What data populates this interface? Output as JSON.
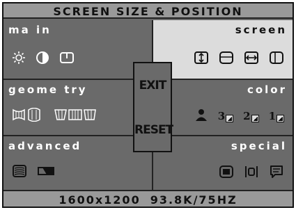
{
  "osd": {
    "title": "SCREEN SIZE & POSITION",
    "footer": {
      "resolution": "1600x1200",
      "frequency": "93.8K/75HZ"
    }
  },
  "panels": {
    "main": {
      "label": "ma in",
      "icons": [
        "brightness-icon",
        "contrast-icon",
        "menu-lock-icon"
      ]
    },
    "screen": {
      "label": "screen",
      "selected": true,
      "icons": [
        "vertical-size-icon",
        "vertical-position-icon",
        "horizontal-size-icon",
        "horizontal-position-icon"
      ]
    },
    "geometry": {
      "label": "geome try",
      "icons": [
        "pincushion-icon",
        "trapezoid-icon",
        "parallelogram-icon"
      ]
    },
    "color": {
      "label": "color",
      "icons": [
        "user-color-icon",
        "color-preset-3-icon",
        "color-preset-2-icon",
        "color-preset-1-icon"
      ],
      "presets": [
        "3",
        "2",
        "1"
      ]
    },
    "advanced": {
      "label": "advanced",
      "icons": [
        "moire-icon",
        "degauss-icon"
      ]
    },
    "special": {
      "label": "special",
      "icons": [
        "recall-icon",
        "zoom-icon",
        "info-icon"
      ]
    }
  },
  "buttons": {
    "exit": "EXIT",
    "reset": "RESET"
  },
  "colors": {
    "panel": "#6a6a6a",
    "selected_panel": "#dcdcdc",
    "bar": "#999999"
  }
}
